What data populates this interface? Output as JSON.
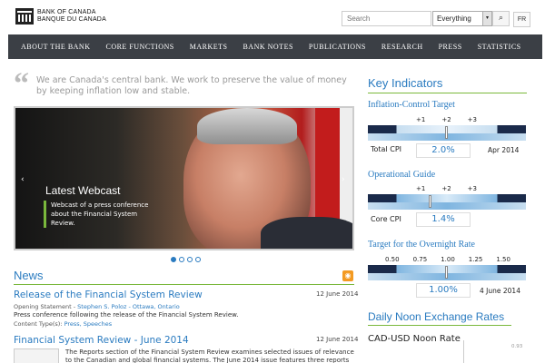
{
  "header": {
    "logo_line1": "BANK OF CANADA",
    "logo_line2": "BANQUE DU CANADA",
    "search_placeholder": "Search",
    "search_scope": "Everything",
    "search_icon": "search-icon",
    "lang": "FR"
  },
  "nav": {
    "items": [
      "ABOUT THE BANK",
      "CORE FUNCTIONS",
      "MARKETS",
      "BANK NOTES",
      "PUBLICATIONS",
      "RESEARCH",
      "PRESS",
      "STATISTICS"
    ]
  },
  "quote": "We are Canada's central bank. We work to preserve the value of money by keeping inflation low and stable.",
  "hero": {
    "title": "Latest Webcast",
    "caption": "Webcast of a press conference about the Financial System Review.",
    "slides": 4,
    "active_slide": 1
  },
  "news": {
    "heading": "News",
    "items": [
      {
        "title": "Release of the Financial System Review",
        "date": "12 June 2014",
        "meta_label": "Opening Statement - ",
        "meta_link": "Stephen S. Poloz - Ottawa, Ontario",
        "desc": "Press conference following the release of the Financial System Review.",
        "types_label": "Content Type(s): ",
        "types_link": "Press, Speeches"
      },
      {
        "title": "Financial System Review - June 2014",
        "date": "12 June 2014",
        "desc": "The Reports section of the Financial System Review examines selected issues of relevance to the Canadian and global financial systems. The June 2014 issue features three reports on financial"
      }
    ]
  },
  "indicators": {
    "heading": "Key Indicators",
    "inflation": {
      "title": "Inflation-Control Target",
      "scale": [
        "+1",
        "+2",
        "+3"
      ],
      "label": "Total CPI",
      "value": "2.0%",
      "date": "Apr 2014"
    },
    "operational": {
      "title": "Operational Guide",
      "scale": [
        "+1",
        "+2",
        "+3"
      ],
      "label": "Core CPI",
      "value": "1.4%"
    },
    "overnight": {
      "title": "Target for the Overnight Rate",
      "scale": [
        "0.50",
        "0.75",
        "1.00",
        "1.25",
        "1.50"
      ],
      "value": "1.00%",
      "date": "4 June 2014"
    }
  },
  "exchange": {
    "heading": "Daily Noon Exchange Rates",
    "subtitle": "CAD-USD Noon Rate",
    "tick": "0.93"
  },
  "colors": {
    "accent": "#2a7bc0",
    "rule": "#7ab83c",
    "nav": "#3b3f45"
  }
}
